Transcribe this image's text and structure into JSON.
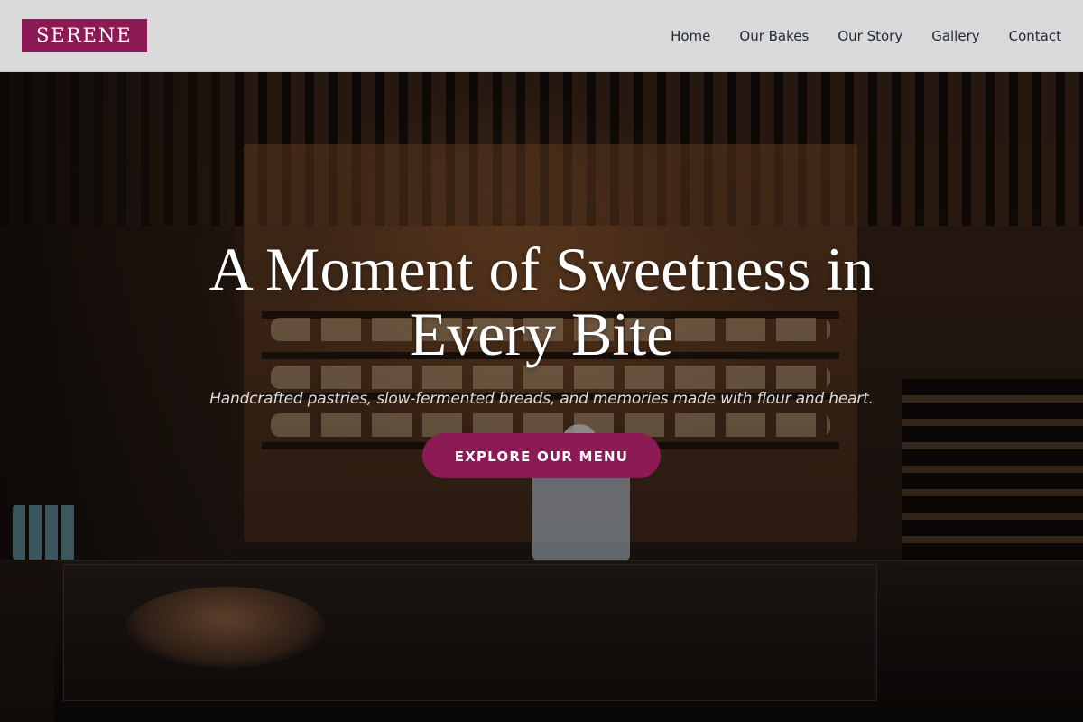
{
  "brand": {
    "logo_text": "SERENE",
    "accent_color": "#8c1a55"
  },
  "nav": {
    "items": [
      {
        "label": "Home"
      },
      {
        "label": "Our Bakes"
      },
      {
        "label": "Our Story"
      },
      {
        "label": "Gallery"
      },
      {
        "label": "Contact"
      }
    ]
  },
  "hero": {
    "title": "A Moment of Sweetness in Every Bite",
    "subtitle": "Handcrafted pastries, slow-fermented breads, and memories made with flour and heart.",
    "cta_label": "EXPLORE OUR MENU",
    "background_image": "bakery-interior-photo"
  }
}
